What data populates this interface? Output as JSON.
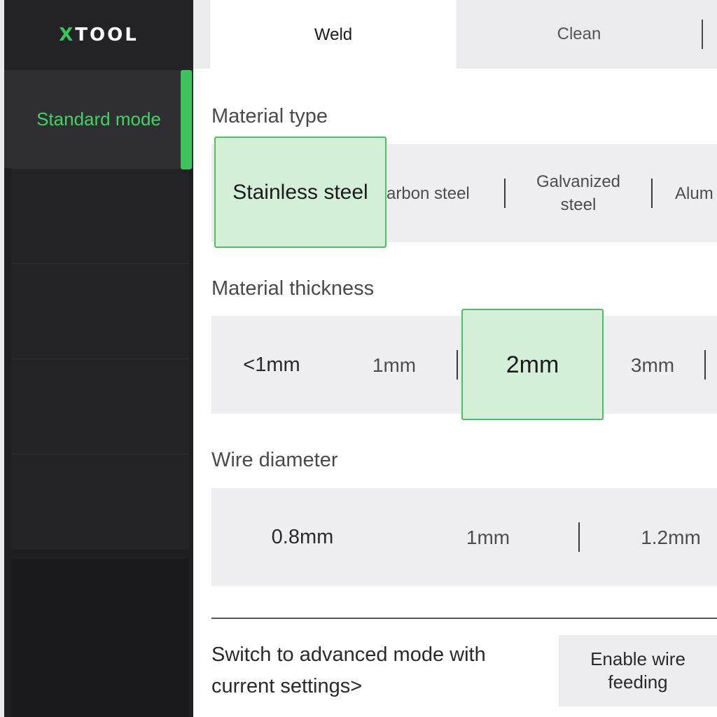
{
  "app": {
    "logo_prefix": "X",
    "logo_rest": "TOOL"
  },
  "sidebar": {
    "active_mode": "Standard mode"
  },
  "tabs": [
    {
      "label": "Weld",
      "active": true
    },
    {
      "label": "Clean",
      "active": false
    }
  ],
  "material_type": {
    "label": "Material type",
    "options": [
      {
        "label": "Stainless steel",
        "selected": true
      },
      {
        "label": "arbon steel",
        "selected": false
      },
      {
        "label": "Galvanized steel",
        "selected": false
      },
      {
        "label": "Alum",
        "selected": false
      }
    ]
  },
  "material_thickness": {
    "label": "Material thickness",
    "options": [
      {
        "label": "<1mm",
        "selected": false
      },
      {
        "label": "1mm",
        "selected": false
      },
      {
        "label": "2mm",
        "selected": true
      },
      {
        "label": "3mm",
        "selected": false
      }
    ]
  },
  "wire_diameter": {
    "label": "Wire diameter",
    "options": [
      {
        "label": "0.8mm",
        "selected": true
      },
      {
        "label": "1mm",
        "selected": false
      },
      {
        "label": "1.2mm",
        "selected": false
      }
    ]
  },
  "footer": {
    "advanced_link": "Switch to advanced mode with current settings>",
    "wire_feeding_button": "Enable wire feeding"
  },
  "colors": {
    "accent": "#3fd461",
    "selected_fill": "#d3efd8",
    "sidebar_bg": "#1f1f21"
  }
}
